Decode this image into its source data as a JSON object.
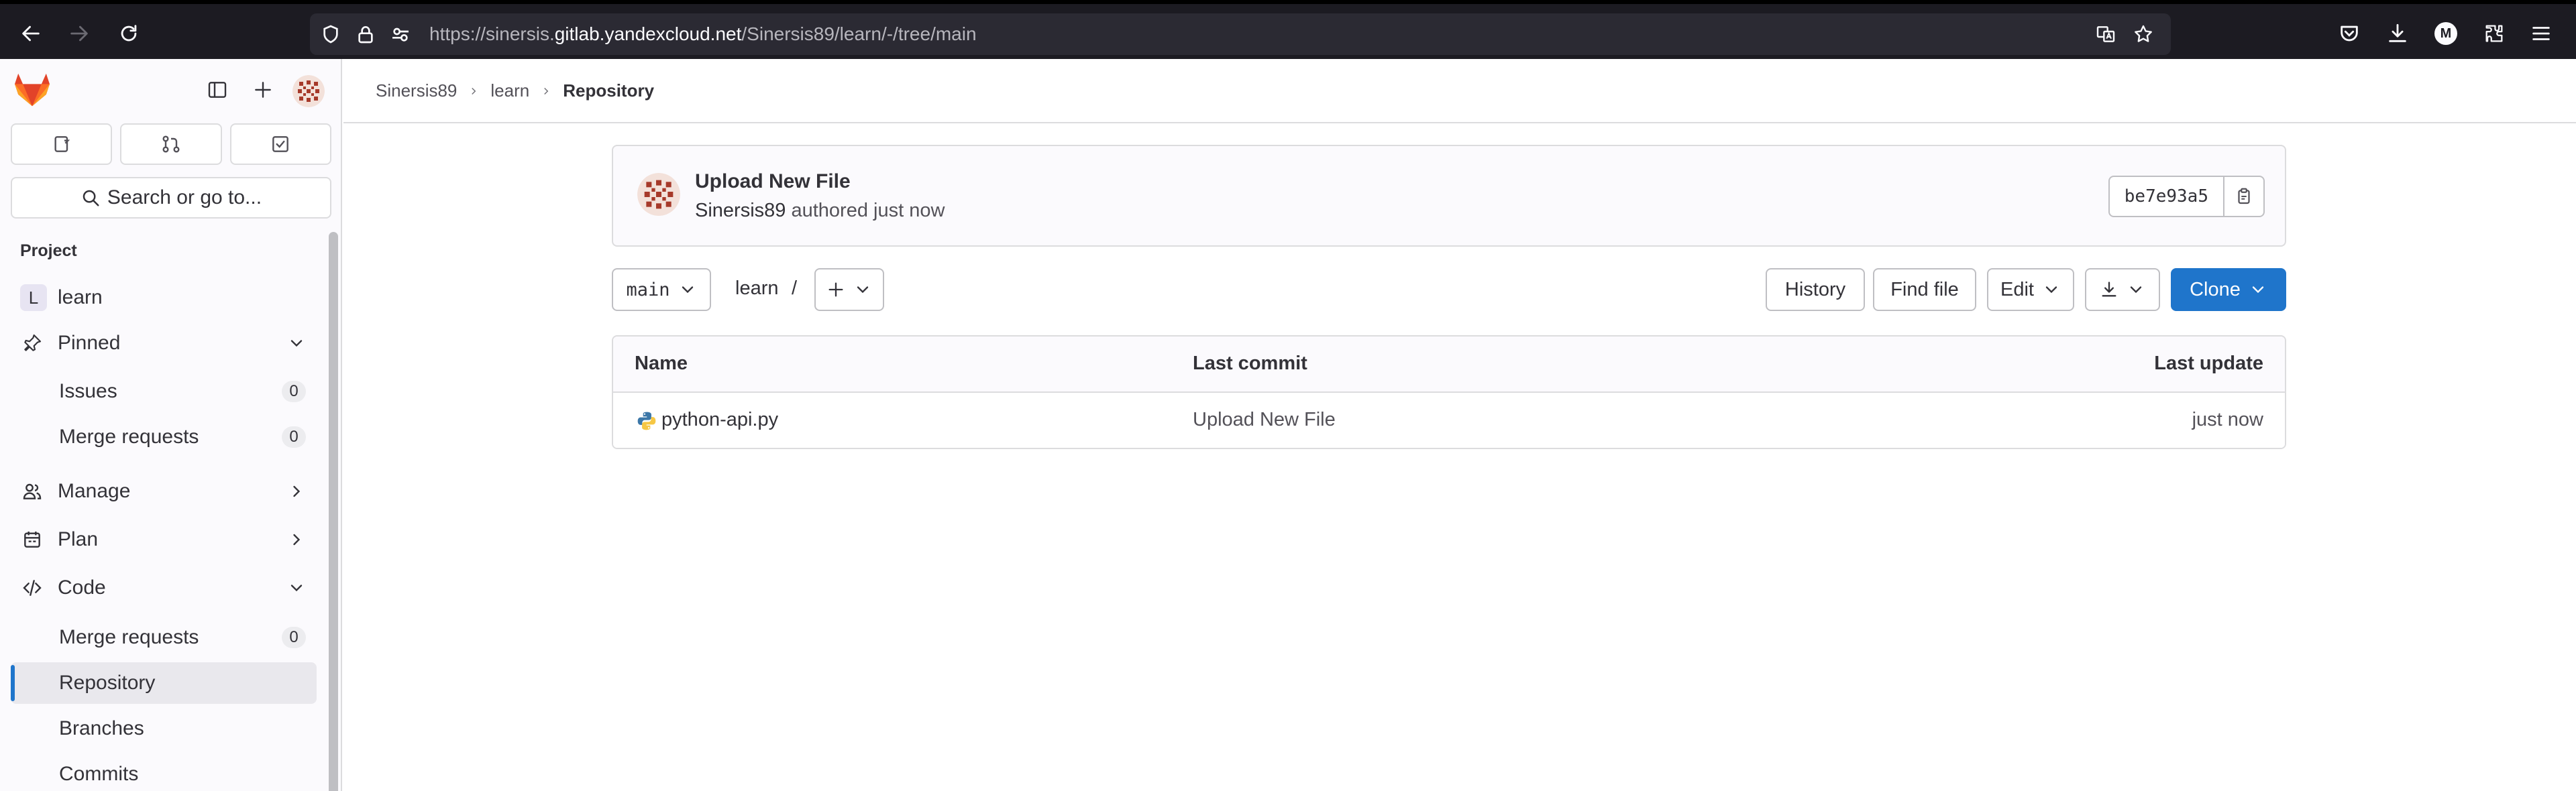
{
  "browser": {
    "url_prefix": "https://sinersis.",
    "url_host": "gitlab.yandexcloud.net",
    "url_path": "/Sinersis89/learn/-/tree/main",
    "profile_initial": "M"
  },
  "sidebar": {
    "search_label": "Search or go to...",
    "section_label": "Project",
    "project": {
      "initial": "L",
      "name": "learn"
    },
    "items": [
      {
        "label": "Pinned"
      },
      {
        "label": "Issues",
        "count": "0"
      },
      {
        "label": "Merge requests",
        "count": "0"
      },
      {
        "label": "Manage"
      },
      {
        "label": "Plan"
      },
      {
        "label": "Code"
      },
      {
        "label": "Merge requests",
        "count": "0"
      },
      {
        "label": "Repository"
      },
      {
        "label": "Branches"
      },
      {
        "label": "Commits"
      }
    ]
  },
  "breadcrumb": [
    "Sinersis89",
    "learn",
    "Repository"
  ],
  "commit": {
    "title": "Upload New File",
    "author": "Sinersis89",
    "meta": "authored just now",
    "sha": "be7e93a5"
  },
  "toolbar": {
    "branch": "main",
    "path": "learn",
    "path_separator": "/",
    "history_label": "History",
    "find_file_label": "Find file",
    "edit_label": "Edit",
    "clone_label": "Clone"
  },
  "table": {
    "headers": [
      "Name",
      "Last commit",
      "Last update"
    ],
    "rows": [
      {
        "name": "python-api.py",
        "last_commit": "Upload New File",
        "last_update": "just now"
      }
    ]
  },
  "colors": {
    "accent": "#1f75cb",
    "browser_dark": "#1c1b22",
    "gitlab_orange": "#fc6d26"
  }
}
